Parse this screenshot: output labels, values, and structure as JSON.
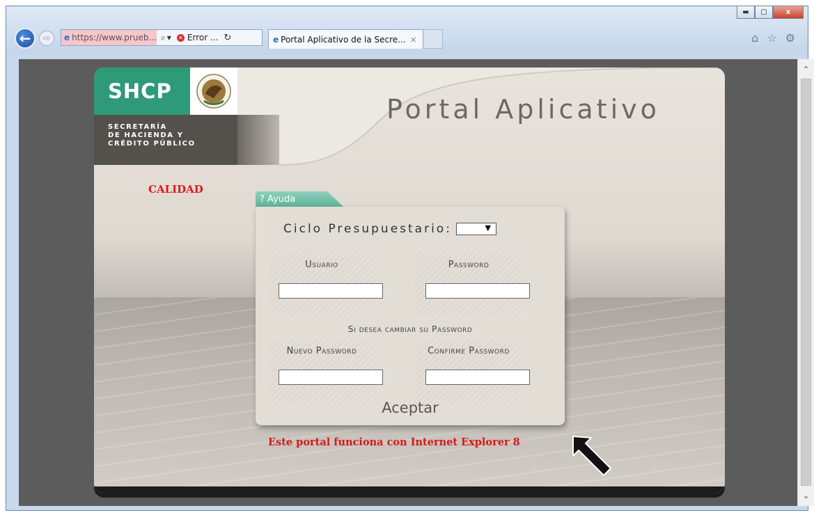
{
  "browser": {
    "address_url": "https://www.prueb...",
    "cert_error_label": "Error ...",
    "tab_title": "Portal Aplicativo de la Secre...",
    "tab_close": "×",
    "back_symbol": "←",
    "forward_symbol": "⇨",
    "minimize_symbol": "▬",
    "maximize_symbol": "▢",
    "close_symbol": "x",
    "icons": [
      "back-icon",
      "forward-icon",
      "ie-icon",
      "search-icon",
      "cert-error-icon",
      "refresh-icon",
      "home-icon",
      "favorites-star-icon",
      "gear-icon"
    ]
  },
  "page": {
    "logo": {
      "acronym": "SHCP",
      "line1": "SECRETARÍA",
      "line2": "DE HACIENDA Y",
      "line3": "CRÉDITO PÚBLICO"
    },
    "title": "Portal Aplicativo",
    "environment_label": "CALIDAD",
    "help_tab": "? Ayuda",
    "ciclo_label": "Ciclo Presupuestario:",
    "fields": {
      "usuario": "Usuario",
      "password": "Password",
      "cambiar": "Si desea cambiar su Password",
      "nuevo": "Nuevo Password",
      "confirme": "Confirme Password"
    },
    "submit_label": "Aceptar",
    "ie_note": "Este portal funciona con Internet Explorer 8"
  },
  "colors": {
    "brand_green": "#2e9a78",
    "brand_dark": "#54504c",
    "accent_red": "#dd1b1b",
    "help_tab": "#5fb49a"
  }
}
